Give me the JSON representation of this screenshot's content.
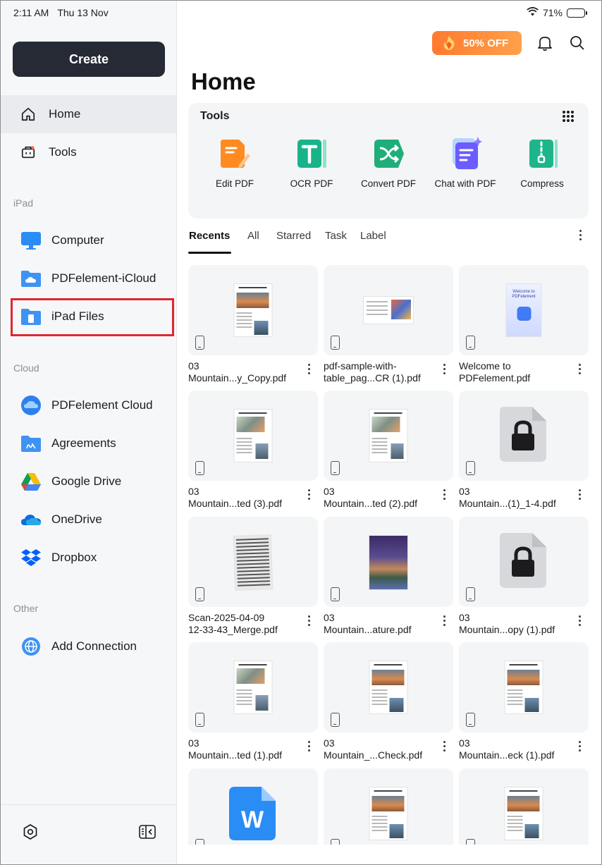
{
  "status": {
    "time": "2:11 AM",
    "date": "Thu 13 Nov",
    "battery": "71%"
  },
  "sidebar": {
    "create_label": "Create",
    "nav": [
      {
        "label": "Home",
        "icon": "home-icon",
        "active": true
      },
      {
        "label": "Tools",
        "icon": "toolbox-icon",
        "active": false
      }
    ],
    "sections": {
      "ipad": "iPad",
      "cloud": "Cloud",
      "other": "Other"
    },
    "ipad_items": [
      {
        "label": "Computer",
        "icon": "monitor-icon"
      },
      {
        "label": "PDFelement-iCloud",
        "icon": "icloud-folder-icon"
      },
      {
        "label": "iPad Files",
        "icon": "ipad-folder-icon"
      }
    ],
    "cloud_items": [
      {
        "label": "PDFelement Cloud",
        "icon": "pdfelement-cloud-icon"
      },
      {
        "label": "Agreements",
        "icon": "agreements-folder-icon"
      },
      {
        "label": "Google Drive",
        "icon": "google-drive-icon"
      },
      {
        "label": "OneDrive",
        "icon": "onedrive-icon"
      },
      {
        "label": "Dropbox",
        "icon": "dropbox-icon"
      }
    ],
    "other_items": [
      {
        "label": "Add Connection",
        "icon": "globe-icon"
      }
    ]
  },
  "header": {
    "promo": "50% OFF",
    "title": "Home"
  },
  "tools": {
    "title": "Tools",
    "items": [
      {
        "label": "Edit PDF",
        "icon": "edit-pdf-icon",
        "color": "#ff8a1f"
      },
      {
        "label": "OCR PDF",
        "icon": "ocr-pdf-icon",
        "color": "#19b38a"
      },
      {
        "label": "Convert PDF",
        "icon": "convert-pdf-icon",
        "color": "#1fae7a"
      },
      {
        "label": "Chat with PDF",
        "icon": "chat-pdf-icon",
        "color": "#6b5cff"
      },
      {
        "label": "Compress",
        "icon": "compress-icon",
        "color": "#1fb58a"
      }
    ]
  },
  "tabs": [
    "Recents",
    "All",
    "Starred",
    "Task",
    "Label"
  ],
  "files": [
    {
      "line1": "03",
      "line2": "Mountain...y_Copy.pdf",
      "thumb": "doc"
    },
    {
      "line1": "pdf-sample-with-",
      "line2": "table_pag...CR (1).pdf",
      "thumb": "landscape"
    },
    {
      "line1": "Welcome to",
      "line2": "PDFelement.pdf",
      "thumb": "welcome",
      "thumb_text": "Welcome to\nPDFelement"
    },
    {
      "line1": "03",
      "line2": "Mountain...ted (3).pdf",
      "thumb": "doc2"
    },
    {
      "line1": "03",
      "line2": "Mountain...ted (2).pdf",
      "thumb": "doc2"
    },
    {
      "line1": "03",
      "line2": "Mountain...(1)_1-4.pdf",
      "thumb": "lock"
    },
    {
      "line1": "Scan-2025-04-09",
      "line2": "12-33-43_Merge.pdf",
      "thumb": "scan"
    },
    {
      "line1": "03",
      "line2": "Mountain...ature.pdf",
      "thumb": "photo"
    },
    {
      "line1": "03",
      "line2": "Mountain...opy (1).pdf",
      "thumb": "lock"
    },
    {
      "line1": "03",
      "line2": "Mountain...ted (1).pdf",
      "thumb": "doc2"
    },
    {
      "line1": "03",
      "line2": "Mountain_...Check.pdf",
      "thumb": "doc"
    },
    {
      "line1": "03",
      "line2": "Mountain...eck (1).pdf",
      "thumb": "doc"
    },
    {
      "line1": "",
      "line2": "",
      "thumb": "word"
    },
    {
      "line1": "",
      "line2": "",
      "thumb": "doc"
    },
    {
      "line1": "",
      "line2": "",
      "thumb": "doc"
    }
  ]
}
